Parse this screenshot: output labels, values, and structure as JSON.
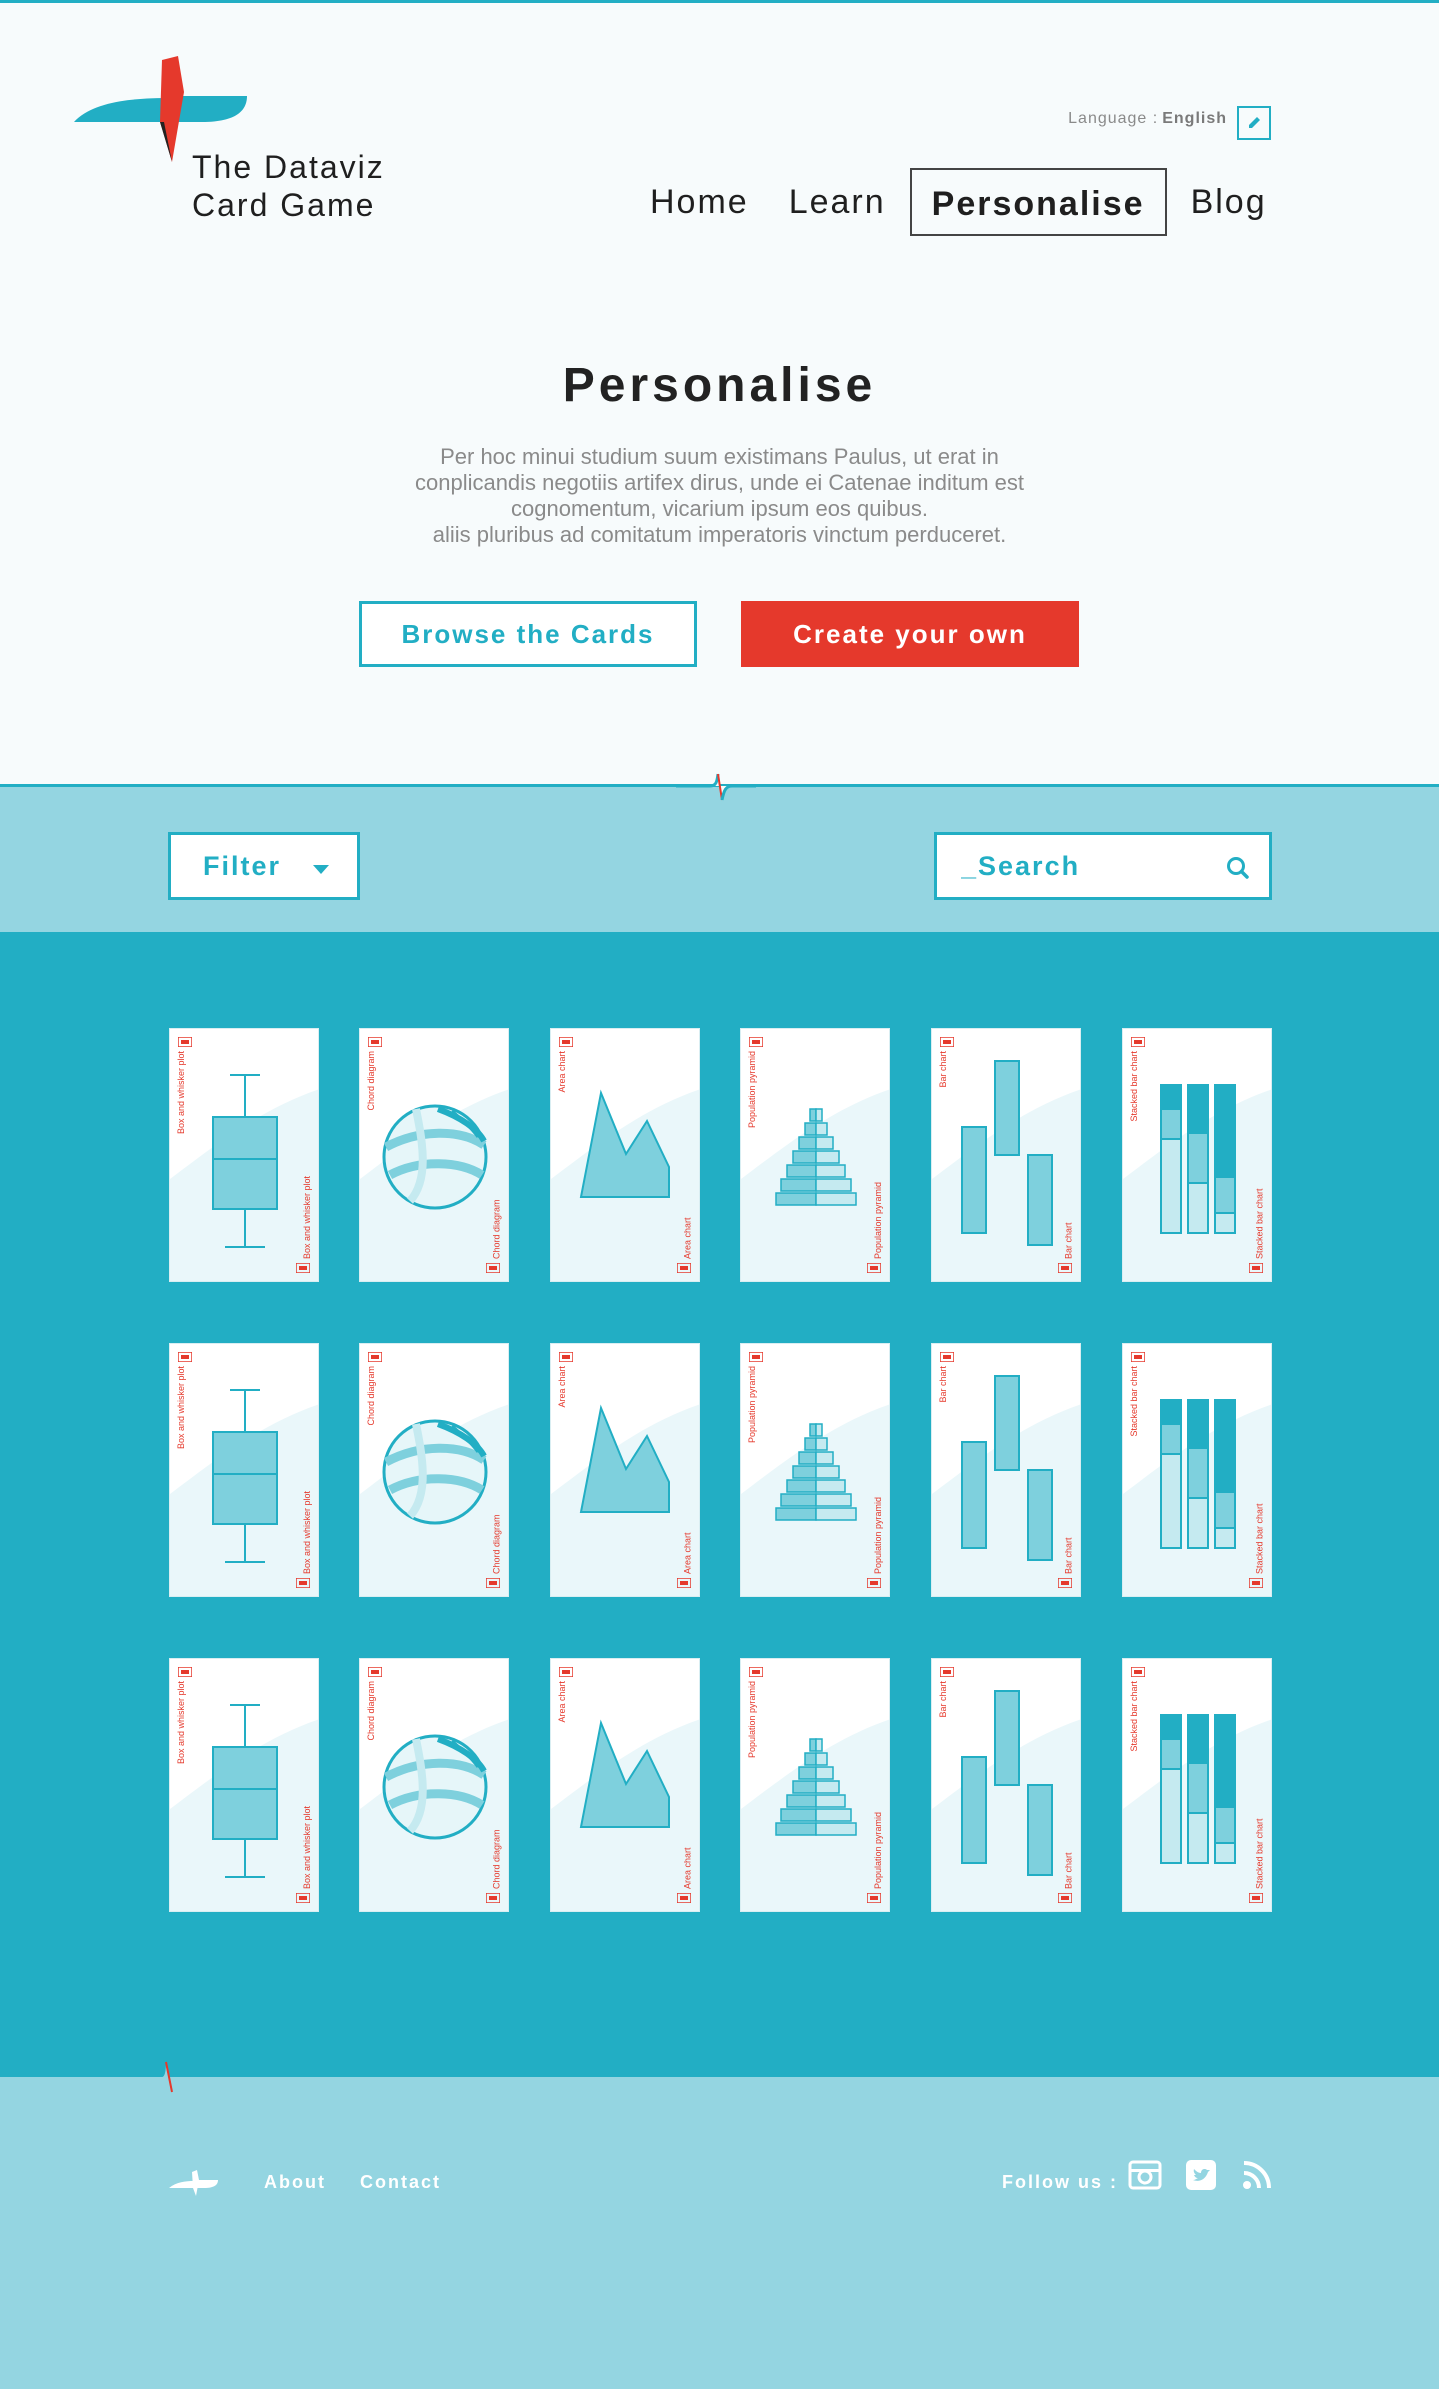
{
  "brand": {
    "line1": "The Dataviz",
    "line2": "Card Game"
  },
  "language": {
    "label": "Language :",
    "value": "English"
  },
  "nav": [
    {
      "label": "Home",
      "active": false
    },
    {
      "label": "Learn",
      "active": false
    },
    {
      "label": "Personalise",
      "active": true
    },
    {
      "label": "Blog",
      "active": false
    }
  ],
  "hero": {
    "title": "Personalise",
    "text": [
      "Per hoc minui studium suum existimans Paulus, ut erat in",
      "conplicandis negotiis artifex dirus, unde ei Catenae inditum est",
      "cognomentum, vicarium ipsum eos quibus.",
      "aliis pluribus ad comitatum imperatoris vinctum perduceret."
    ],
    "browse_label": "Browse the Cards",
    "create_label": "Create your own"
  },
  "filter": {
    "label": "Filter"
  },
  "search": {
    "placeholder": "_Search"
  },
  "cards": {
    "types": [
      {
        "kind": "boxplot",
        "name": "Box and whisker plot"
      },
      {
        "kind": "chord",
        "name": "Chord diagram"
      },
      {
        "kind": "area",
        "name": "Area chart"
      },
      {
        "kind": "pyramid",
        "name": "Population pyramid"
      },
      {
        "kind": "bar",
        "name": "Bar chart"
      },
      {
        "kind": "stacked",
        "name": "Stacked bar chart"
      }
    ],
    "rows": 3
  },
  "footer": {
    "about": "About",
    "contact": "Contact",
    "follow": "Follow us :"
  },
  "icons": {
    "edit": "pencil-icon",
    "search": "search-icon",
    "filter_caret": "caret-down-icon",
    "social": [
      "instagram-icon",
      "twitter-icon",
      "rss-icon"
    ]
  },
  "colors": {
    "accent": "#22aec4",
    "red": "#e5392c",
    "light": "#94d5e1"
  }
}
